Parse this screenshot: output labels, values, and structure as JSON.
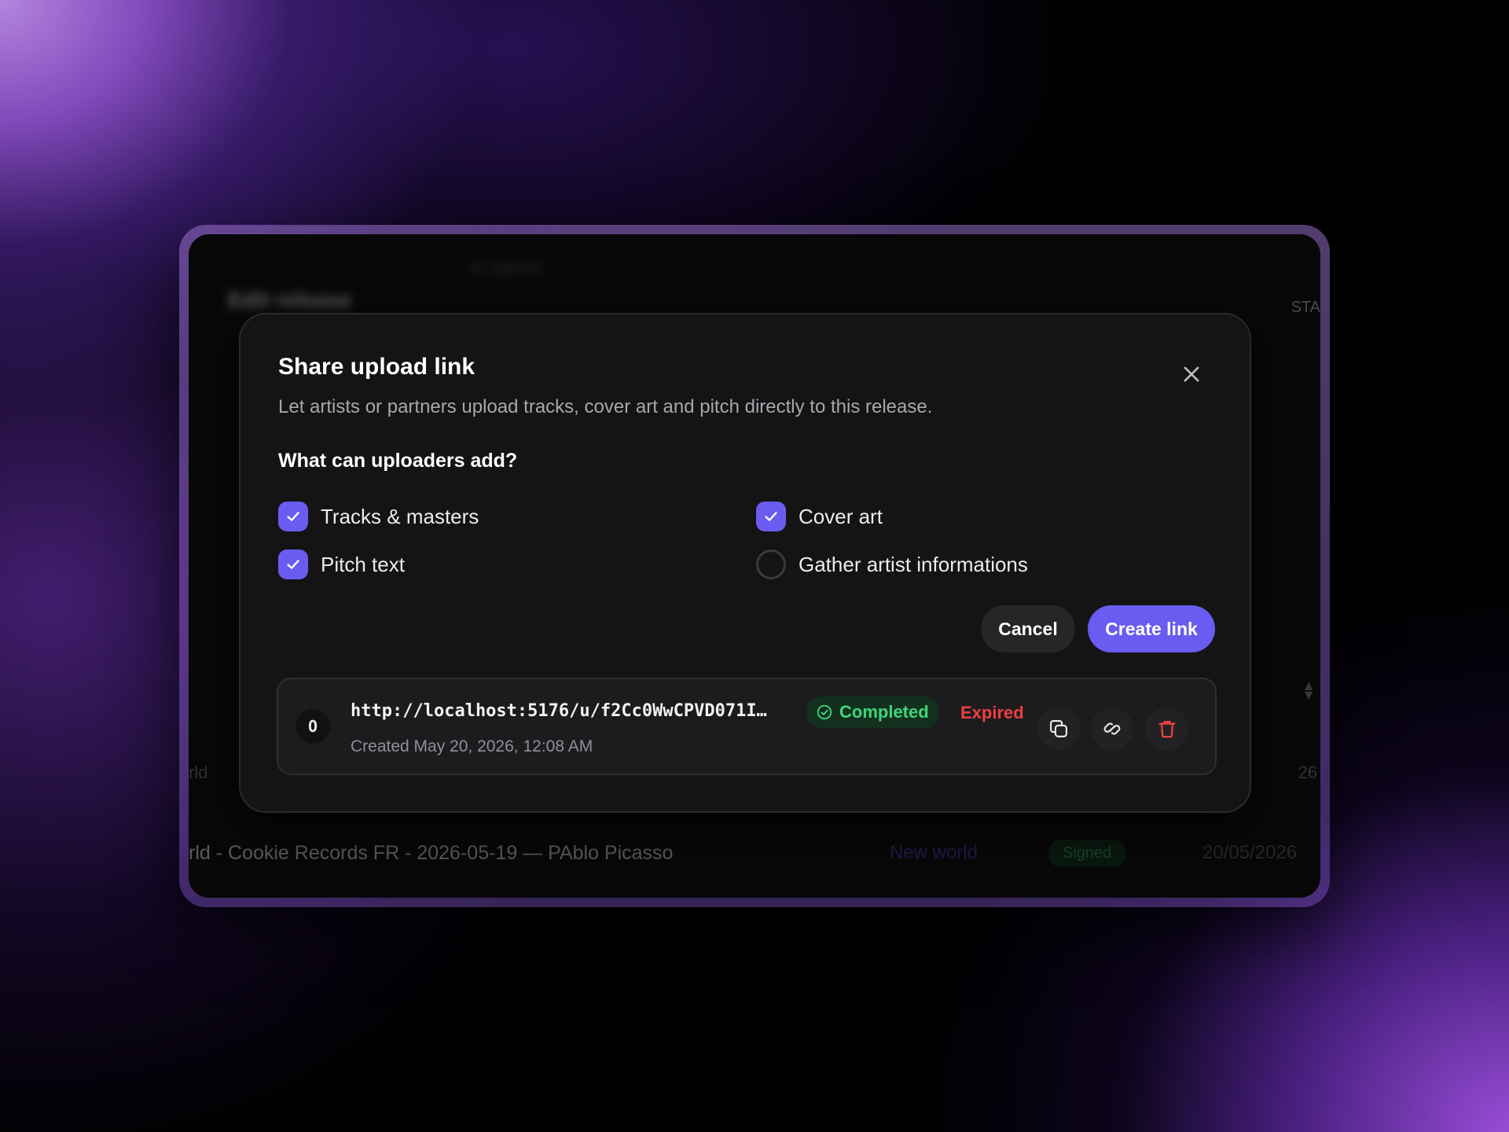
{
  "background": {
    "title": "Edit release",
    "tag": "Is signed",
    "status_col": "STA",
    "left_fragment": "rld",
    "right_fragment": "26",
    "row": {
      "title": "rld - Cookie Records FR - 2026-05-19 — PAblo Picasso",
      "label": "New world",
      "badge": "Signed",
      "date": "20/05/2026"
    }
  },
  "modal": {
    "title": "Share upload link",
    "description": "Let artists or partners upload tracks, cover art and pitch directly to this release.",
    "section_title": "What can uploaders add?",
    "options": [
      {
        "label": "Tracks & masters",
        "checked": true
      },
      {
        "label": "Cover art",
        "checked": true
      },
      {
        "label": "Pitch text",
        "checked": true
      },
      {
        "label": "Gather artist informations",
        "checked": false
      }
    ],
    "cancel_label": "Cancel",
    "create_label": "Create link",
    "link": {
      "avatar": "O",
      "url": "http://localhost:5176/u/f2Cc0WwCPVD071I…",
      "created": "Created May 20, 2026, 12:08 AM",
      "status_completed": "Completed",
      "status_expired": "Expired"
    }
  },
  "colors": {
    "accent": "#6a5cf0",
    "completed": "#3fd67a",
    "expired": "#ef3e3e",
    "delete": "#ef4444"
  },
  "icons": {
    "close": "close-icon",
    "check": "check-icon",
    "copy": "copy-icon",
    "link": "link-icon",
    "delete": "trash-icon",
    "completed": "check-circle-icon"
  }
}
